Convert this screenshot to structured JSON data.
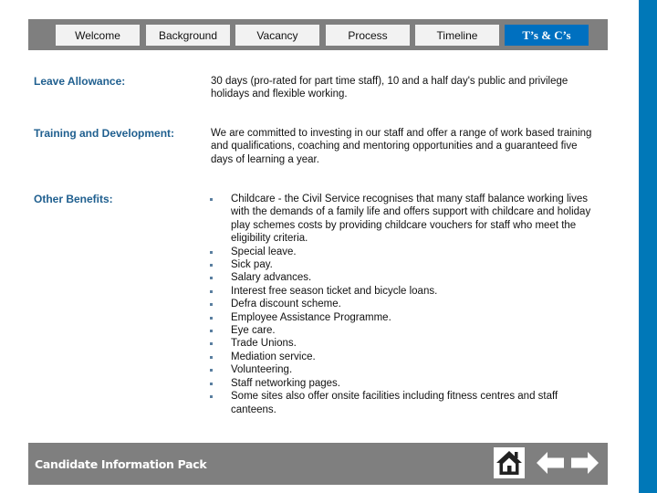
{
  "nav": {
    "tabs": [
      {
        "label": "Welcome",
        "active": false
      },
      {
        "label": "Background",
        "active": false
      },
      {
        "label": "Vacancy",
        "active": false
      },
      {
        "label": "Process",
        "active": false
      },
      {
        "label": "Timeline",
        "active": false
      },
      {
        "label": "T’s & C’s",
        "active": true
      }
    ]
  },
  "content": {
    "leave": {
      "label": "Leave Allowance:",
      "text": "30 days (pro-rated for part time staff), 10 and a half day's public and privilege holidays and flexible working."
    },
    "training": {
      "label": "Training and Development:",
      "text": "We are committed to investing in our staff and offer a range of work based training and qualifications, coaching and mentoring opportunities and a guaranteed five days of learning a year."
    },
    "benefits": {
      "label": "Other Benefits:",
      "items": [
        "Childcare - the Civil Service recognises that many staff balance working lives with the demands of a family life and offers support with childcare and holiday play schemes costs by providing childcare vouchers for staff who meet the eligibility criteria.",
        "Special leave.",
        "Sick pay.",
        "Salary advances.",
        "Interest free season ticket and bicycle loans.",
        "Defra discount scheme.",
        "Employee Assistance Programme.",
        "Eye care.",
        "Trade Unions.",
        "Mediation service.",
        "Volunteering.",
        "Staff networking pages.",
        "Some sites also offer onsite facilities including fitness centres and staff canteens."
      ]
    }
  },
  "footer": {
    "title": "Candidate Information Pack",
    "icons": {
      "home": "home-icon",
      "back": "arrow-left-icon",
      "forward": "arrow-right-icon"
    }
  },
  "colors": {
    "accent": "#0070c0",
    "stripe": "#0078b8",
    "bar_gray": "#7f7f7f",
    "label_blue": "#1f5f8f"
  }
}
